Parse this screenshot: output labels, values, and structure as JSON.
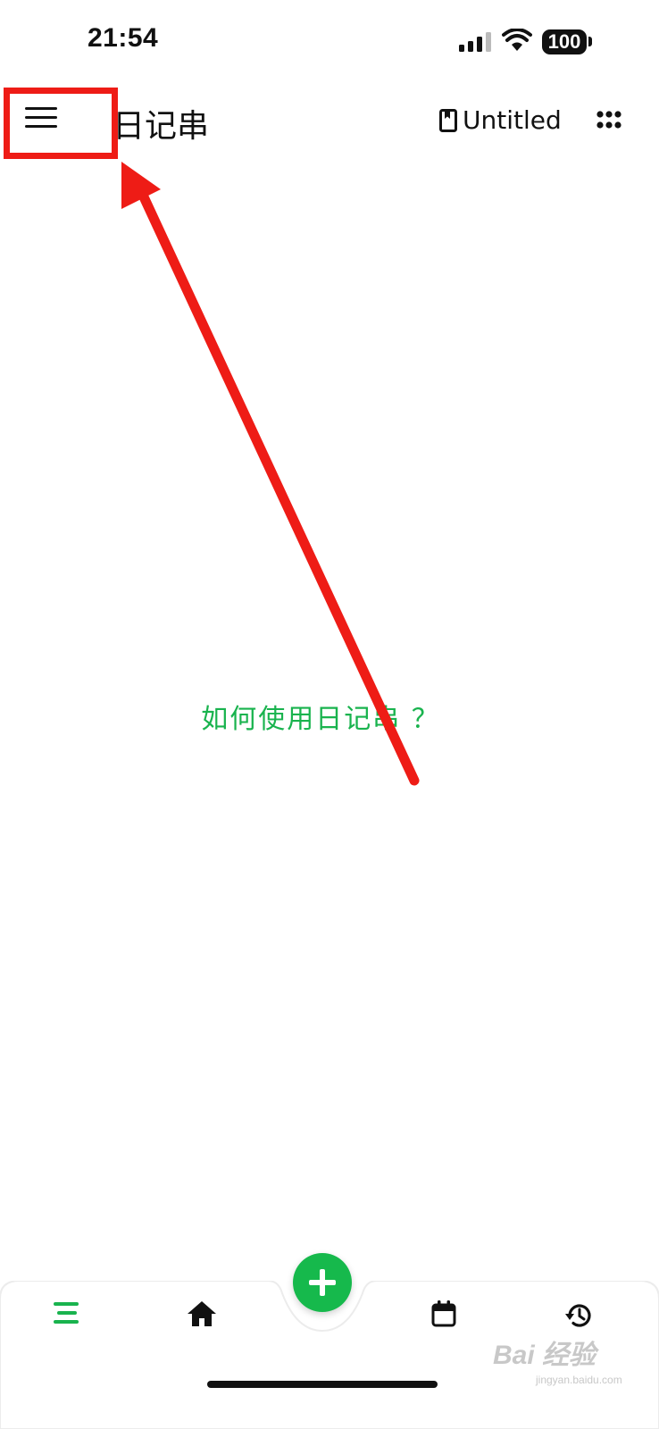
{
  "status_bar": {
    "time": "21:54",
    "battery": "100"
  },
  "header": {
    "title": "日记串",
    "notebook_name": "Untitled"
  },
  "content": {
    "help_link": "如何使用日记串 ？"
  },
  "bottom_nav": {
    "active_color": "#19b34e",
    "items": [
      "list-icon",
      "home-icon",
      "add-icon",
      "calendar-icon",
      "history-icon"
    ]
  },
  "annotation": {
    "color": "#ee1c16"
  },
  "watermark": {
    "text": "Bai 经验",
    "sub": "jingyan.baidu.com"
  }
}
